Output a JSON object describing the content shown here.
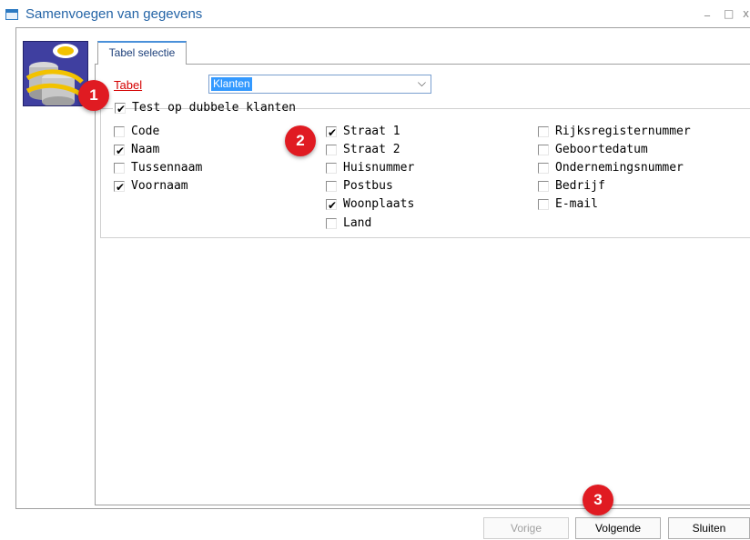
{
  "window": {
    "title": "Samenvoegen van gegevens",
    "minimize_glyph": "_",
    "maximize_glyph": "□",
    "close_glyph": "x"
  },
  "tabs": [
    {
      "label": "Tabel selectie",
      "active": true
    }
  ],
  "tabel": {
    "label": "Tabel",
    "selected_value": "Klanten",
    "chevron_glyph": "⌵"
  },
  "group": {
    "label": "Test op dubbele klanten",
    "checked": true
  },
  "fields": {
    "col1": [
      {
        "label": "Code",
        "checked": false
      },
      {
        "label": "Naam",
        "checked": true
      },
      {
        "label": "Tussennaam",
        "checked": false
      },
      {
        "label": "Voornaam",
        "checked": true
      }
    ],
    "col2": [
      {
        "label": "Straat 1",
        "checked": true
      },
      {
        "label": "Straat 2",
        "checked": false
      },
      {
        "label": "Huisnummer",
        "checked": false
      },
      {
        "label": "Postbus",
        "checked": false
      },
      {
        "label": "Woonplaats",
        "checked": true
      },
      {
        "label": "Land",
        "checked": false
      }
    ],
    "col3": [
      {
        "label": "Rijksregisternummer",
        "checked": false
      },
      {
        "label": "Geboortedatum",
        "checked": false
      },
      {
        "label": "Ondernemingsnummer",
        "checked": false
      },
      {
        "label": "Bedrijf",
        "checked": false
      },
      {
        "label": "E-mail",
        "checked": false
      }
    ]
  },
  "buttons": {
    "previous": "Vorige",
    "next": "Volgende",
    "close": "Sluiten"
  },
  "callouts": [
    "1",
    "2",
    "3"
  ],
  "colors": {
    "title": "#2464a6",
    "callout": "#e01b22",
    "selection": "#3399ff",
    "tabel_label": "#d40000"
  },
  "check_glyph": "✔"
}
